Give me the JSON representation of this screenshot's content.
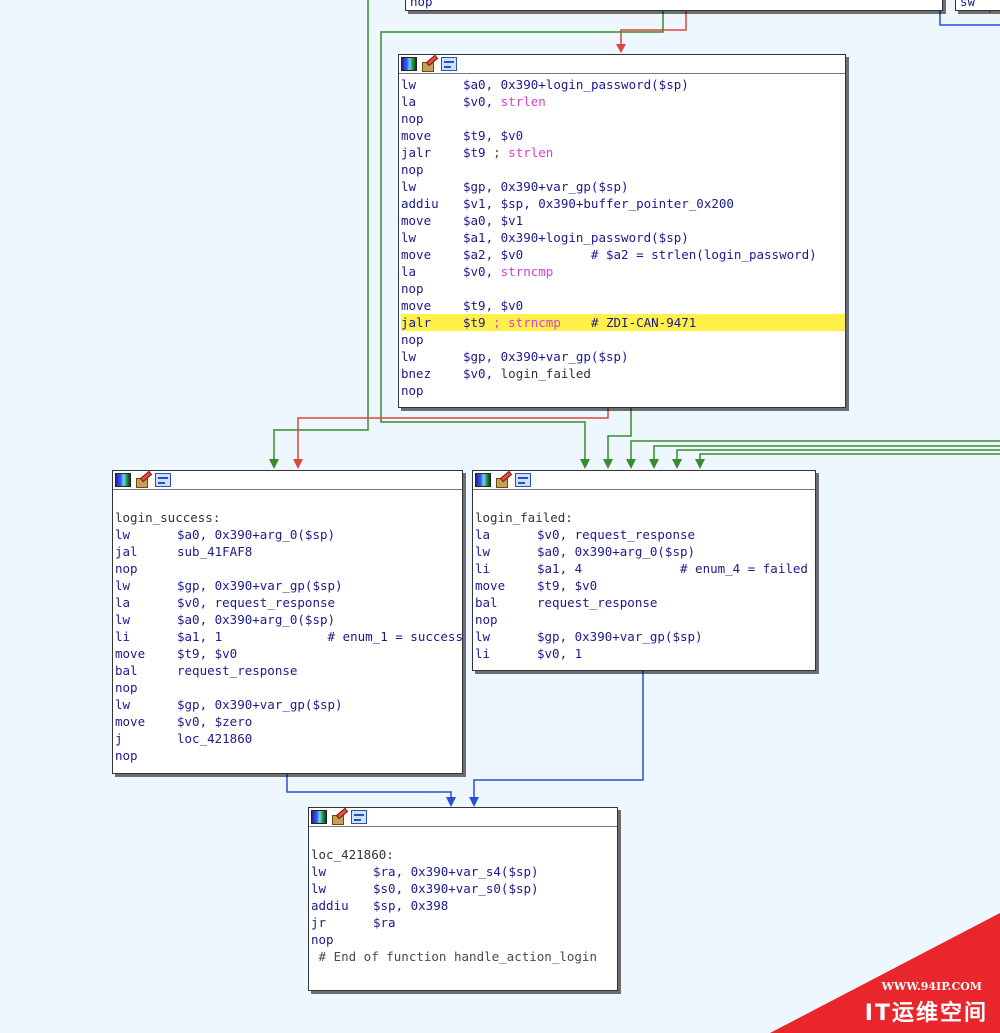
{
  "top_partial": {
    "mnemonic": "nop",
    "right_fragment": "sw"
  },
  "block_main": {
    "lines": [
      {
        "m": "lw",
        "o": [
          {
            "t": "$a0, 0x390+"
          },
          {
            "t": "login_password",
            "c": "cm2"
          },
          {
            "t": "($sp)"
          }
        ]
      },
      {
        "m": "la",
        "o": [
          {
            "t": "$v0, "
          },
          {
            "t": "strlen",
            "c": "fn"
          }
        ]
      },
      {
        "m": "nop",
        "o": []
      },
      {
        "m": "move",
        "o": [
          {
            "t": "$t9, $v0"
          }
        ]
      },
      {
        "m": "jalr",
        "o": [
          {
            "t": "$t9 "
          },
          {
            "t": "; ",
            "c": "cm"
          },
          {
            "t": "strlen",
            "c": "fn"
          }
        ]
      },
      {
        "m": "nop",
        "o": []
      },
      {
        "m": "lw",
        "o": [
          {
            "t": "$gp, 0x390+var_gp($sp)"
          }
        ]
      },
      {
        "m": "addiu",
        "o": [
          {
            "t": "$v1, $sp, 0x390+buffer_pointer_0x200"
          }
        ]
      },
      {
        "m": "move",
        "o": [
          {
            "t": "$a0, $v1"
          }
        ]
      },
      {
        "m": "lw",
        "o": [
          {
            "t": "$a1, 0x390+login_password($sp)"
          }
        ]
      },
      {
        "m": "move",
        "o": [
          {
            "t": "$a2, $v0         # $a2 = strlen(login_password)"
          }
        ]
      },
      {
        "m": "la",
        "o": [
          {
            "t": "$v0, "
          },
          {
            "t": "strncmp",
            "c": "fn"
          }
        ]
      },
      {
        "m": "nop",
        "o": []
      },
      {
        "m": "move",
        "o": [
          {
            "t": "$t9, $v0"
          }
        ]
      },
      {
        "m": "jalr",
        "hl": true,
        "o": [
          {
            "t": "$t9 "
          },
          {
            "t": "; strncmp",
            "c": "fn"
          },
          {
            "t": "    # ZDI-CAN-9471"
          }
        ]
      },
      {
        "m": "nop",
        "o": []
      },
      {
        "m": "lw",
        "o": [
          {
            "t": "$gp, 0x390+var_gp($sp)"
          }
        ]
      },
      {
        "m": "bnez",
        "o": [
          {
            "t": "$v0, "
          },
          {
            "t": "login_failed",
            "c": "lbl"
          }
        ]
      },
      {
        "m": "nop",
        "o": []
      }
    ]
  },
  "block_success": {
    "label": "login_success:",
    "lines": [
      {
        "m": "lw",
        "o": [
          {
            "t": "$a0, 0x390+arg_0($sp)"
          }
        ]
      },
      {
        "m": "jal",
        "o": [
          {
            "t": "sub_41FAF8"
          }
        ]
      },
      {
        "m": "nop",
        "o": []
      },
      {
        "m": "lw",
        "o": [
          {
            "t": "$gp, 0x390+var_gp($sp)"
          }
        ]
      },
      {
        "m": "la",
        "o": [
          {
            "t": "$v0, request_response"
          }
        ]
      },
      {
        "m": "lw",
        "o": [
          {
            "t": "$a0, 0x390+arg_0($sp)"
          }
        ]
      },
      {
        "m": "li",
        "o": [
          {
            "t": "$a1, 1              # enum_1 = success"
          }
        ]
      },
      {
        "m": "move",
        "o": [
          {
            "t": "$t9, $v0"
          }
        ]
      },
      {
        "m": "bal",
        "o": [
          {
            "t": "request_response"
          }
        ]
      },
      {
        "m": "nop",
        "o": []
      },
      {
        "m": "lw",
        "o": [
          {
            "t": "$gp, 0x390+var_gp($sp)"
          }
        ]
      },
      {
        "m": "move",
        "o": [
          {
            "t": "$v0, $zero"
          }
        ]
      },
      {
        "m": "j",
        "o": [
          {
            "t": "loc_421860"
          }
        ]
      },
      {
        "m": "nop",
        "o": []
      }
    ]
  },
  "block_failed": {
    "label": "login_failed:",
    "lines": [
      {
        "m": "la",
        "o": [
          {
            "t": "$v0, request_response"
          }
        ]
      },
      {
        "m": "lw",
        "o": [
          {
            "t": "$a0, 0x390+arg_0($sp)"
          }
        ]
      },
      {
        "m": "li",
        "o": [
          {
            "t": "$a1, 4             # enum_4 = failed"
          }
        ]
      },
      {
        "m": "move",
        "o": [
          {
            "t": "$t9, $v0"
          }
        ]
      },
      {
        "m": "bal",
        "o": [
          {
            "t": "request_response"
          }
        ]
      },
      {
        "m": "nop",
        "o": []
      },
      {
        "m": "lw",
        "o": [
          {
            "t": "$gp, 0x390+var_gp($sp)"
          }
        ]
      },
      {
        "m": "li",
        "o": [
          {
            "t": "$v0, 1"
          }
        ]
      }
    ]
  },
  "block_end": {
    "label": "loc_421860:",
    "lines": [
      {
        "m": "lw",
        "o": [
          {
            "t": "$ra, 0x390+var_s4($sp)"
          }
        ]
      },
      {
        "m": "lw",
        "o": [
          {
            "t": "$s0, 0x390+var_s0($sp)"
          }
        ]
      },
      {
        "m": "addiu",
        "o": [
          {
            "t": "$sp, 0x398"
          }
        ]
      },
      {
        "m": "jr",
        "o": [
          {
            "t": "$ra"
          }
        ]
      },
      {
        "m": "nop",
        "o": []
      }
    ],
    "footer": " # End of function handle_action_login"
  },
  "watermark": {
    "url": "WWW.94IP.COM",
    "name": "IT运维空间"
  },
  "colors": {
    "edge_true": "#3a8a2e",
    "edge_false": "#e0473b",
    "edge_uncond": "#2a4fd8",
    "highlight": "#fff04a"
  }
}
